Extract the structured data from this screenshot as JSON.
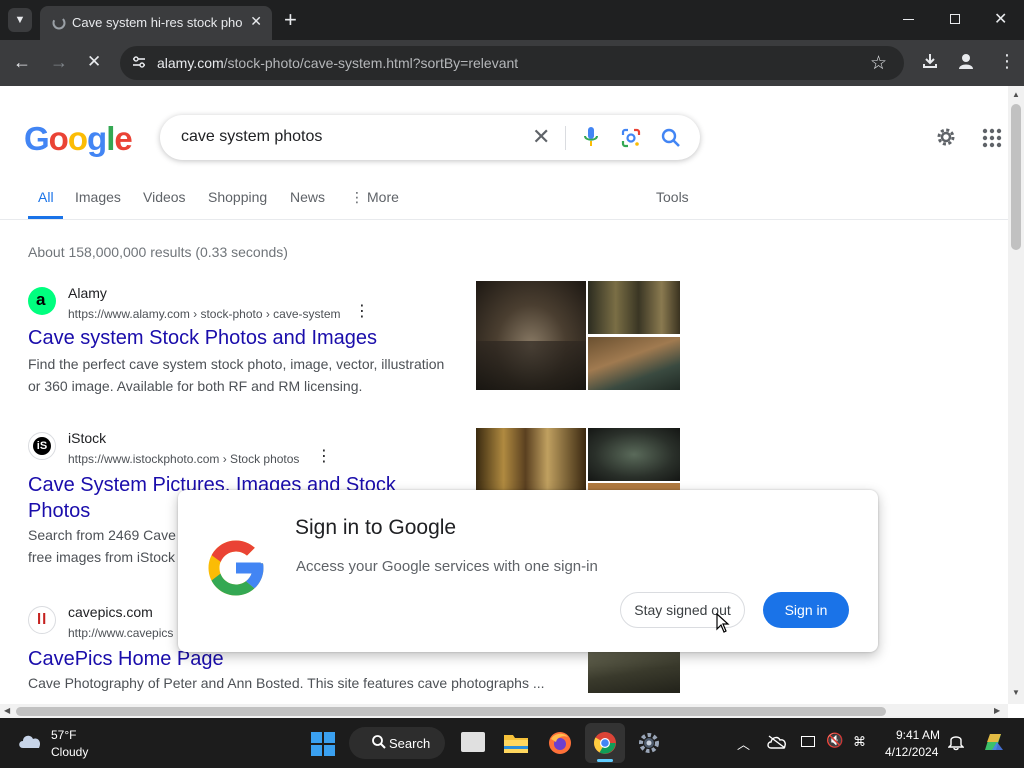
{
  "browser": {
    "tab_title": "Cave system hi-res stock photo",
    "new_tab_symbol": "+",
    "url_domain": "alamy.com",
    "url_path": "/stock-photo/cave-system.html?sortBy=relevant"
  },
  "google": {
    "logo_letters": [
      "G",
      "o",
      "o",
      "g",
      "l",
      "e"
    ],
    "logo_colors": [
      "#4285f4",
      "#ea4335",
      "#fbbc05",
      "#4285f4",
      "#34a853",
      "#ea4335"
    ],
    "query": "cave system photos",
    "tabs": [
      "All",
      "Images",
      "Videos",
      "Shopping",
      "News",
      "More"
    ],
    "tools_label": "Tools",
    "stats": "About 158,000,000 results (0.33 seconds)"
  },
  "results": [
    {
      "site": "Alamy",
      "url": "https://www.alamy.com › stock-photo › cave-system",
      "title": "Cave system Stock Photos and Images",
      "snippet_line1": "Find the perfect cave system stock photo, image, vector, illustration",
      "snippet_line2": "or 360 image. Available for both RF and RM licensing.",
      "favicon_letter": "a"
    },
    {
      "site": "iStock",
      "url": "https://www.istockphoto.com › Stock photos",
      "title_line1": "Cave System Pictures, Images and Stock",
      "title_line2": "Photos",
      "snippet_line1": "Search from 2469 Cave",
      "snippet_line2": "free images from iStock",
      "favicon_letter": "iS"
    },
    {
      "site": "cavepics.com",
      "url": "http://www.cavepics",
      "title": "CavePics Home Page",
      "snippet_line1": "Cave Photography of Peter and Ann Bosted. This site features cave photographs ...",
      "favicon_letter": "ll"
    }
  ],
  "dialog": {
    "title": "Sign in to Google",
    "description": "Access your Google services with one sign-in",
    "stay_label": "Stay signed out",
    "signin_label": "Sign in"
  },
  "taskbar": {
    "temp": "57°F",
    "weather": "Cloudy",
    "search_label": "Search",
    "time": "9:41 AM",
    "date": "4/12/2024"
  },
  "colors": {
    "link": "#1a0dab",
    "accent": "#1a73e8",
    "chrome_dark": "#1f2021"
  }
}
